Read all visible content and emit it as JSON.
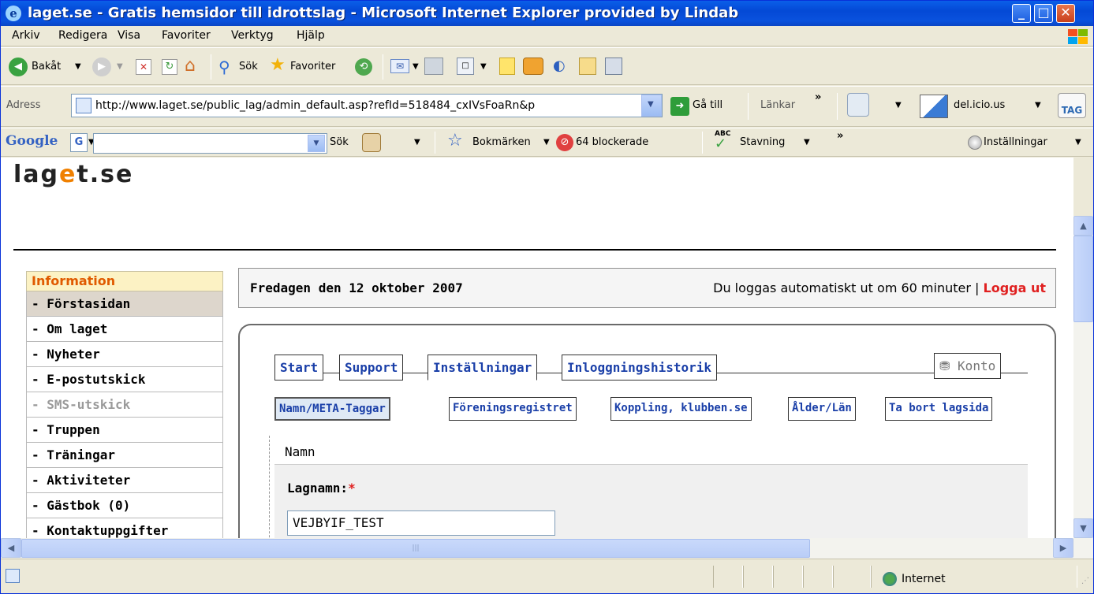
{
  "window": {
    "title": "laget.se - Gratis hemsidor till idrottslag - Microsoft Internet Explorer provided by Lindab"
  },
  "menu": [
    "Arkiv",
    "Redigera",
    "Visa",
    "Favoriter",
    "Verktyg",
    "Hjälp"
  ],
  "toolbar": {
    "back": "Bakåt",
    "search": "Sök",
    "favorites": "Favoriter"
  },
  "address": {
    "label": "Adress",
    "url": "http://www.laget.se/public_lag/admin_default.asp?refId=518484_cxIVsFoaRn&p",
    "go": "Gå till",
    "links": "Länkar",
    "delicious": "del.icio.us",
    "tag": "TAG"
  },
  "google": {
    "logo": "Google",
    "search": "Sök",
    "bookmarks": "Bokmärken",
    "blocked": "64 blockerade",
    "spelling": "Stavning",
    "settings": "Inställningar",
    "abc": "ABC"
  },
  "page": {
    "logo_a": "lag",
    "logo_dot": "e",
    "logo_b": "t.se",
    "date": "Fredagen den 12 oktober 2007",
    "logout_text": "Du loggas automatiskt ut om 60 minuter | ",
    "logout_link": "Logga ut"
  },
  "sidebar": {
    "header": "Information",
    "items": [
      {
        "label": "- Förstasidan"
      },
      {
        "label": "- Om laget"
      },
      {
        "label": "- Nyheter"
      },
      {
        "label": "- E-postutskick"
      },
      {
        "label": "- SMS-utskick"
      },
      {
        "label": "- Truppen"
      },
      {
        "label": "- Träningar"
      },
      {
        "label": "- Aktiviteter"
      },
      {
        "label": "- Gästbok (0)"
      },
      {
        "label": "- Kontaktuppgifter"
      }
    ]
  },
  "tabs": [
    "Start",
    "Support",
    "Inställningar",
    "Inloggningshistorik"
  ],
  "konto": "Konto",
  "subtabs": [
    "Namn/META-Taggar",
    "Föreningsregistret",
    "Koppling, klubben.se",
    "Ålder/Län",
    "Ta bort lagsida"
  ],
  "form": {
    "section": "Namn",
    "lagnamn_label": "Lagnamn:",
    "required_mark": "*",
    "lagnamn_value": "VEJBYIF_TEST"
  },
  "status": {
    "zone": "Internet"
  }
}
